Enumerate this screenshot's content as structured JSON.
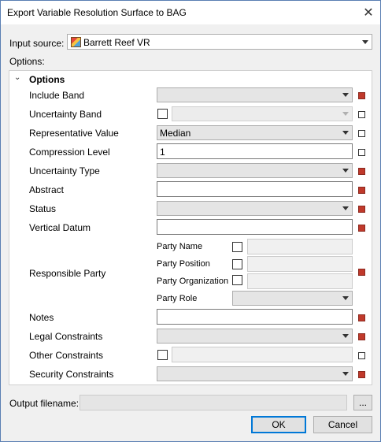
{
  "window": {
    "title": "Export Variable Resolution Surface to BAG"
  },
  "input_source": {
    "label": "Input source:",
    "value": "Barrett Reef VR"
  },
  "options_label": "Options:",
  "group": {
    "title": "Options"
  },
  "fields": {
    "include_band": {
      "label": "Include Band"
    },
    "uncertainty_band": {
      "label": "Uncertainty Band"
    },
    "representative_value": {
      "label": "Representative Value",
      "value": "Median"
    },
    "compression_level": {
      "label": "Compression Level",
      "value": "1"
    },
    "uncertainty_type": {
      "label": "Uncertainty Type"
    },
    "abstract": {
      "label": "Abstract"
    },
    "status": {
      "label": "Status"
    },
    "vertical_datum": {
      "label": "Vertical Datum"
    },
    "responsible_party": {
      "label": "Responsible Party",
      "party_name": "Party Name",
      "party_position": "Party Position",
      "party_organization": "Party Organization",
      "party_role": "Party Role"
    },
    "notes": {
      "label": "Notes"
    },
    "legal_constraints": {
      "label": "Legal Constraints"
    },
    "other_constraints": {
      "label": "Other Constraints"
    },
    "security_constraints": {
      "label": "Security Constraints"
    }
  },
  "output": {
    "label": "Output filename:",
    "browse": "..."
  },
  "buttons": {
    "ok": "OK",
    "cancel": "Cancel"
  },
  "colors": {
    "required_marker": "#c0392b",
    "default_button_border": "#0078d7"
  }
}
